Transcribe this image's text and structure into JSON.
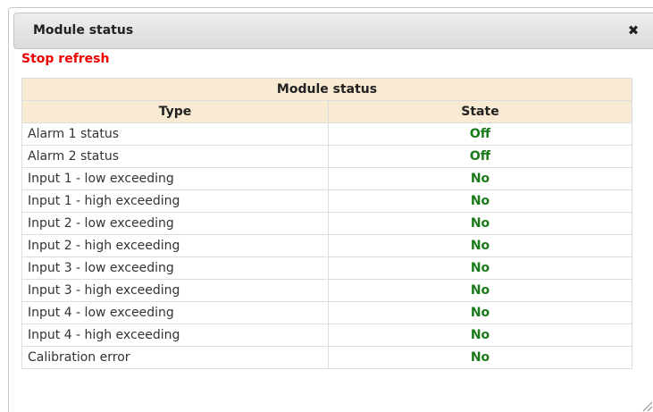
{
  "dialog": {
    "title": "Module status",
    "close_icon": "close-icon",
    "close_glyph": "✖"
  },
  "stop_refresh_label": "Stop refresh",
  "table": {
    "caption": "Module status",
    "columns": [
      "Type",
      "State"
    ],
    "rows": [
      {
        "type": "Alarm 1 status",
        "state": "Off"
      },
      {
        "type": "Alarm 2 status",
        "state": "Off"
      },
      {
        "type": "Input 1 - low exceeding",
        "state": "No"
      },
      {
        "type": "Input 1 - high exceeding",
        "state": "No"
      },
      {
        "type": "Input 2 - low exceeding",
        "state": "No"
      },
      {
        "type": "Input 2 - high exceeding",
        "state": "No"
      },
      {
        "type": "Input 3 - low exceeding",
        "state": "No"
      },
      {
        "type": "Input 3 - high exceeding",
        "state": "No"
      },
      {
        "type": "Input 4 - low exceeding",
        "state": "No"
      },
      {
        "type": "Input 4 - high exceeding",
        "state": "No"
      },
      {
        "type": "Calibration error",
        "state": "No"
      }
    ]
  },
  "colors": {
    "stop_refresh": "#ee0000",
    "state_ok": "#1a7a1a",
    "header_bg": "#f9ebd3"
  }
}
